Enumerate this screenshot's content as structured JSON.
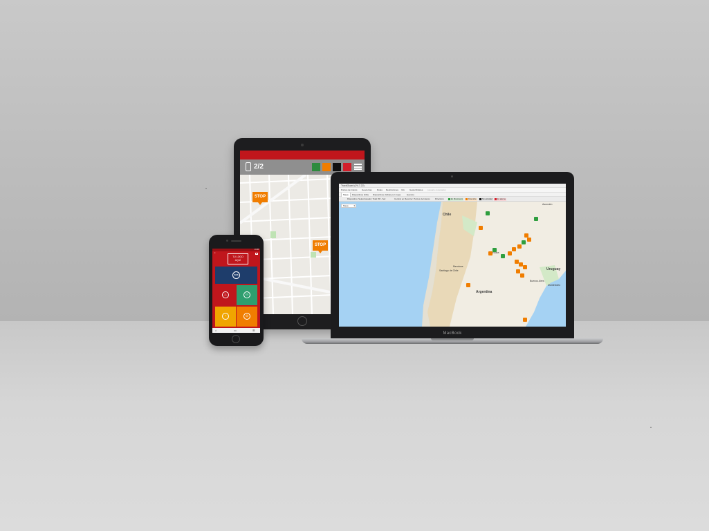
{
  "tablet": {
    "counter": "2/2",
    "swatches": [
      "#2e8b3e",
      "#f07d00",
      "#111111",
      "#d21f2b"
    ],
    "stop_label_1": "STOP",
    "stop_label_2": "STOP"
  },
  "laptop": {
    "brand": "MacBook",
    "window_title": "TrackGuard (V4.7.22)",
    "menu": [
      "Puntos de Interés",
      "Geocercas",
      "Rutas",
      "Restricciones",
      "Info",
      "Gestor/Indices",
      "(usuario conectado)"
    ],
    "tabs": [
      "Mapa",
      "Dispositivos Grilla",
      "Dispositivos visibles por mapa",
      "Eventos"
    ],
    "filter": {
      "device": "Dispositivo: Seleccionado | Total: 68 - Sel:",
      "center": "Centrar en Recorrer",
      "poi": "Puntos de Interés",
      "direction": "Dirección"
    },
    "legend": [
      {
        "label": "En Movimiento",
        "color": "#2e9e3e"
      },
      {
        "label": "Detenidos",
        "color": "#f07d00"
      },
      {
        "label": "Sin actividad",
        "color": "#111111"
      },
      {
        "label": "En alarma",
        "color": "#d21f2b"
      }
    ],
    "map_type": "Mapa",
    "places": [
      "Chile",
      "Asunción",
      "Argentina",
      "Uruguay",
      "Montevideo",
      "Buenos Aires",
      "Santiago de Chile",
      "Córdoba",
      "Mendoza"
    ]
  },
  "phone": {
    "status_time": "13:45",
    "logo_text_line1": "TU LOGO",
    "logo_text_line2": "AQUÍ",
    "sos_label": "SOS",
    "tiles": [
      {
        "color": "#c0161c",
        "icon": "fire-icon",
        "glyph": "♨"
      },
      {
        "color": "#2e9e6e",
        "icon": "person-icon",
        "glyph": "⚇"
      },
      {
        "color": "#f0a500",
        "icon": "timer-icon",
        "glyph": "◔"
      },
      {
        "color": "#f07d00",
        "icon": "location-icon",
        "glyph": "⊙"
      }
    ]
  }
}
